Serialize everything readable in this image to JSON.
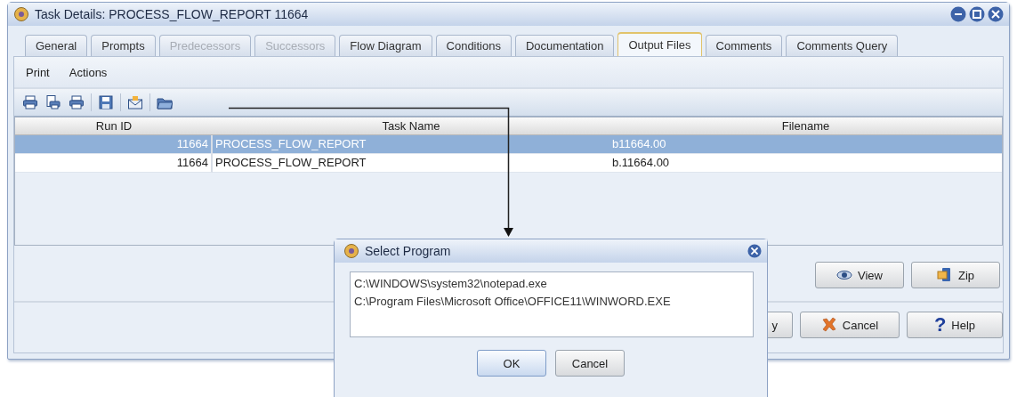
{
  "window": {
    "title": "Task Details: PROCESS_FLOW_REPORT  11664"
  },
  "tabs": [
    {
      "label": "General",
      "selected": false,
      "disabled": false
    },
    {
      "label": "Prompts",
      "selected": false,
      "disabled": false
    },
    {
      "label": "Predecessors",
      "selected": false,
      "disabled": true
    },
    {
      "label": "Successors",
      "selected": false,
      "disabled": true
    },
    {
      "label": "Flow Diagram",
      "selected": false,
      "disabled": false
    },
    {
      "label": "Conditions",
      "selected": false,
      "disabled": false
    },
    {
      "label": "Documentation",
      "selected": false,
      "disabled": false
    },
    {
      "label": "Output Files",
      "selected": true,
      "disabled": false
    },
    {
      "label": "Comments",
      "selected": false,
      "disabled": false
    },
    {
      "label": "Comments Query",
      "selected": false,
      "disabled": false
    }
  ],
  "menu": [
    "Print",
    "Actions"
  ],
  "toolbar": [
    {
      "kind": "printer"
    },
    {
      "kind": "print-preview"
    },
    {
      "kind": "printer"
    },
    {
      "kind": "save"
    },
    {
      "kind": "envelope"
    },
    {
      "kind": "folder"
    }
  ],
  "table": {
    "columns": [
      "Run ID",
      "Task Name",
      "Filename"
    ],
    "rows": [
      {
        "cells": [
          "11664",
          "PROCESS_FLOW_REPORT",
          "b11664.00"
        ],
        "selected": true
      },
      {
        "cells": [
          "11664",
          "PROCESS_FLOW_REPORT",
          "b.11664.00"
        ],
        "selected": false
      }
    ]
  },
  "file_buttons": [
    {
      "label": "View",
      "kind": "view"
    },
    {
      "label": "Zip",
      "kind": "zip"
    }
  ],
  "bottom_buttons": [
    {
      "label": "y",
      "kind": "plain"
    },
    {
      "label": "Cancel",
      "kind": "cancel"
    },
    {
      "label": "Help",
      "kind": "help",
      "glyph": "?"
    }
  ],
  "dialog": {
    "title": "Select Program",
    "programs": [
      "C:\\WINDOWS\\system32\\notepad.exe",
      "C:\\Program Files\\Microsoft Office\\OFFICE11\\WINWORD.EXE"
    ],
    "buttons": [
      {
        "label": "OK",
        "default": true
      },
      {
        "label": "Cancel",
        "default": false
      }
    ]
  }
}
